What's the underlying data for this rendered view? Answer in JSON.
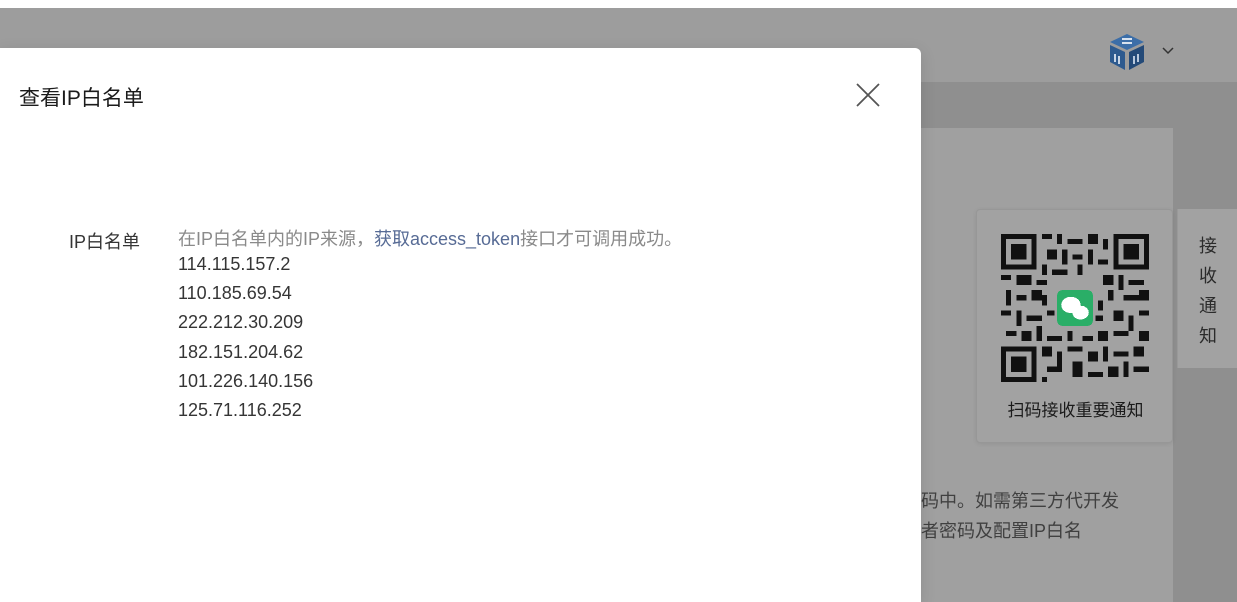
{
  "dialog": {
    "title": "查看IP白名单",
    "row_label": "IP白名单",
    "hint_prefix": "在IP白名单内的IP来源，",
    "hint_link": "获取access_token",
    "hint_suffix": "接口才可调用成功。",
    "ips": [
      "114.115.157.2",
      "110.185.69.54",
      "222.212.30.209",
      "182.151.204.62",
      "101.226.140.156",
      "125.71.116.252"
    ]
  },
  "background": {
    "qr_caption": "扫码接收重要通知",
    "notify_tab": "接收通知",
    "desc_line1": "码中。如需第三方代开发",
    "desc_line2": "者密码及配置IP白名"
  },
  "icons": {
    "close": "close-icon",
    "logo": "cube-logo-icon",
    "chevron": "chevron-down-icon",
    "wechat": "wechat-icon",
    "qr": "qr-code-icon"
  },
  "colors": {
    "link": "#576b95",
    "overlay": "#a3a3a3",
    "wechat_green": "#2aae67"
  }
}
